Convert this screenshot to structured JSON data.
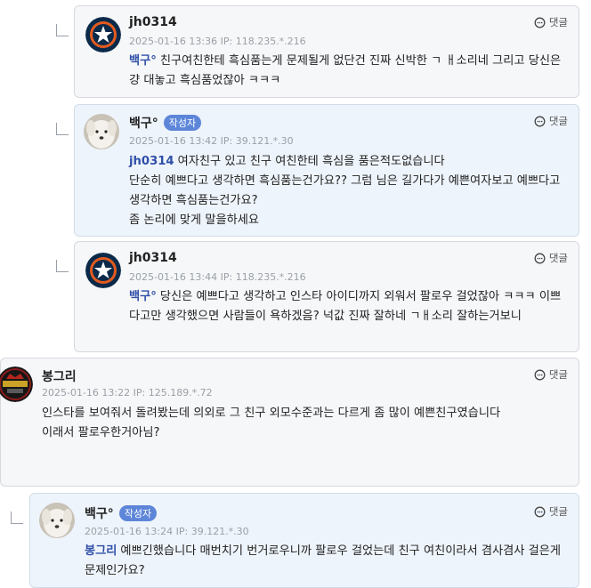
{
  "ui": {
    "reply_label": "댓글",
    "author_badge": "작성자"
  },
  "comments": [
    {
      "nick": "jh0314",
      "meta": "2025-01-16 13:36 IP: 118.235.*.216",
      "mention": "백구°",
      "paragraphs": [
        "친구여친한테 흑심품는게 문제될게 없단건 진짜 신박한 ㄱ ㅐ소리네 그리고 당신은 걍 대놓고 흑심품었잖아 ㅋㅋㅋ"
      ]
    },
    {
      "nick": "백구°",
      "meta": "2025-01-16 13:42 IP: 39.121.*.30",
      "mention": "jh0314",
      "paragraphs": [
        "여자친구 있고 친구 여친한테 흑심을 품은적도없습니다",
        "단순히 예쁘다고 생각하면 흑심품는건가요?? 그럼 님은 길가다가 예쁜여자보고 예쁘다고 생각하면 흑심품는건가요?",
        "좀 논리에 맞게 말을하세요"
      ]
    },
    {
      "nick": "jh0314",
      "meta": "2025-01-16 13:44 IP: 118.235.*.216",
      "mention": "백구°",
      "paragraphs": [
        "당신은 예쁘다고 생각하고 인스타 아이디까지 외워서 팔로우 걸었잖아 ㅋㅋㅋ 이쁘다고만 생각했으면 사람들이 욕하겠음? 넉값 진짜 잘하네 ㄱㅐ소리 잘하는거보니"
      ]
    },
    {
      "nick": "봉그리",
      "meta": "2025-01-16 13:22 IP: 125.189.*.72",
      "mention": "",
      "paragraphs": [
        "인스타를 보여줘서 돌려봤는데 의외로 그 친구 외모수준과는 다르게 좀 많이 예쁜친구였습니다",
        " ",
        "이래서 팔로우한거아님?"
      ]
    },
    {
      "nick": "백구°",
      "meta": "2025-01-16 13:24 IP: 39.121.*.30",
      "mention": "봉그리",
      "paragraphs": [
        "예쁘긴했습니다 매번치기 번거로우니까 팔로우 걸었는데 친구 여친이라서 겸사겸사 걸은게 문제인가요?"
      ]
    }
  ]
}
